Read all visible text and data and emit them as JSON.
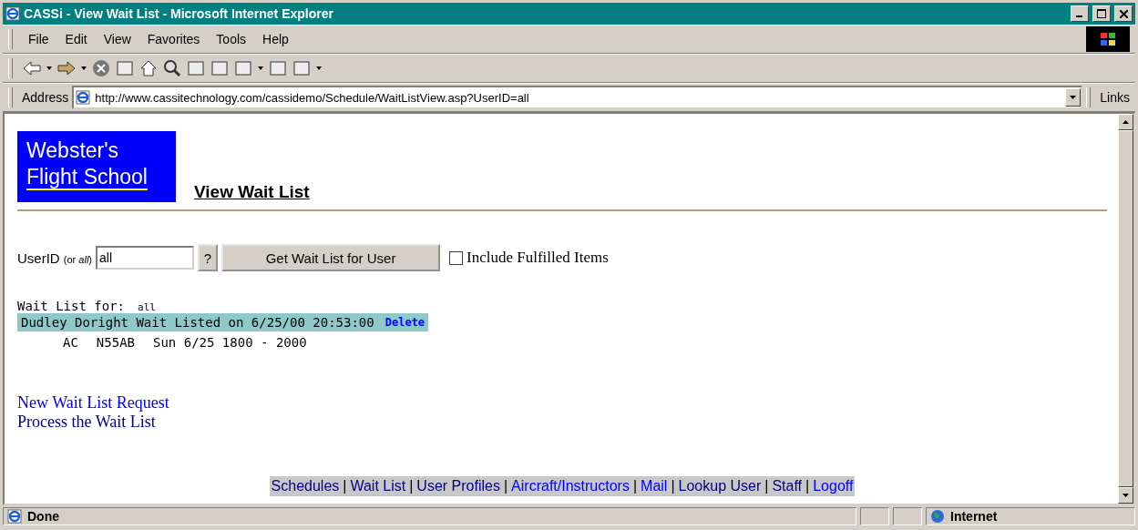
{
  "window": {
    "title": "CASSi - View Wait List - Microsoft Internet Explorer"
  },
  "menu": [
    "File",
    "Edit",
    "View",
    "Favorites",
    "Tools",
    "Help"
  ],
  "address": {
    "label": "Address",
    "url": "http://www.cassitechnology.com/cassidemo/Schedule/WaitListView.asp?UserID=all",
    "links": "Links"
  },
  "logo": {
    "line1": "Webster's",
    "line2": "Flight School"
  },
  "heading": "View Wait List",
  "form": {
    "label": "UserID",
    "hint_pre": "(or ",
    "hint_em": "all",
    "hint_post": ")",
    "value": "all",
    "help": "?",
    "button": "Get Wait List for User",
    "include": {
      "label": "Include Fulfilled Items",
      "checked": false
    }
  },
  "waitlist": {
    "label": "Wait List for:",
    "user": "all",
    "entries": [
      {
        "header": "Dudley Doright Wait Listed on 6/25/00 20:53:00",
        "delete": "Delete",
        "details": [
          "AC",
          "N55AB",
          "Sun 6/25 1800 - 2000"
        ]
      }
    ]
  },
  "links": [
    {
      "text": "New Wait List Request",
      "visited": false
    },
    {
      "text": "Process the Wait List",
      "visited": true
    }
  ],
  "nav_separator": "|",
  "nav": [
    {
      "text": "Schedules",
      "visited": true
    },
    {
      "text": "Wait List",
      "visited": true
    },
    {
      "text": "User Profiles",
      "visited": true
    },
    {
      "text": "Aircraft/Instructors",
      "visited": false
    },
    {
      "text": "Mail",
      "visited": false
    },
    {
      "text": "Lookup User",
      "visited": true
    },
    {
      "text": "Staff",
      "visited": true
    },
    {
      "text": "Logoff",
      "visited": false
    }
  ],
  "status": {
    "text": "Done",
    "zone": "Internet"
  }
}
